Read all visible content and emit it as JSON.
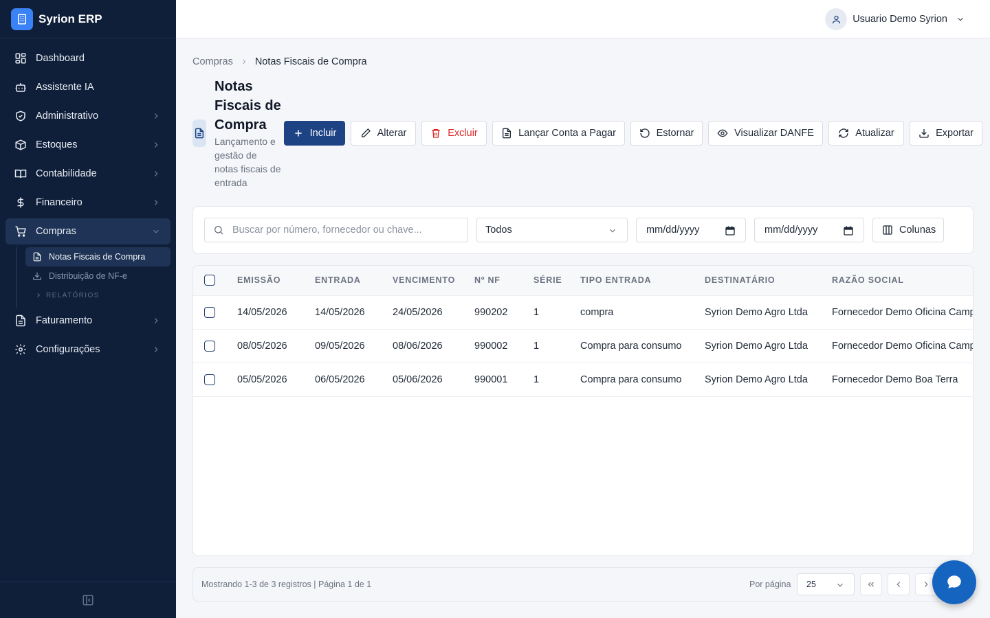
{
  "app": {
    "name": "Syrion ERP"
  },
  "sidebar": {
    "items": [
      {
        "label": "Dashboard",
        "icon": "dashboard-icon"
      },
      {
        "label": "Assistente IA",
        "icon": "bot-icon"
      },
      {
        "label": "Administrativo",
        "icon": "shield-icon"
      },
      {
        "label": "Estoques",
        "icon": "box-icon"
      },
      {
        "label": "Contabilidade",
        "icon": "book-icon"
      },
      {
        "label": "Financeiro",
        "icon": "dollar-icon"
      },
      {
        "label": "Compras",
        "icon": "cart-icon"
      },
      {
        "label": "Faturamento",
        "icon": "document-icon"
      },
      {
        "label": "Configurações",
        "icon": "gear-icon"
      }
    ],
    "compras_sub": [
      {
        "label": "Notas Fiscais de Compra"
      },
      {
        "label": "Distribuição de NF-e"
      }
    ],
    "section_label": "RELATÓRIOS"
  },
  "topbar": {
    "user_name": "Usuario Demo Syrion"
  },
  "breadcrumb": {
    "parent": "Compras",
    "current": "Notas Fiscais de Compra"
  },
  "page": {
    "title": "Notas Fiscais de Compra",
    "subtitle": "Lançamento e gestão de notas fiscais de entrada"
  },
  "actions": {
    "incluir": "Incluir",
    "alterar": "Alterar",
    "excluir": "Excluir",
    "lancar": "Lançar Conta a Pagar",
    "estornar": "Estornar",
    "danfe": "Visualizar DANFE",
    "atualizar": "Atualizar",
    "exportar": "Exportar"
  },
  "filters": {
    "search_placeholder": "Buscar por número, fornecedor ou chave...",
    "status_value": "Todos",
    "date_from_placeholder": "mm/dd/yyyy",
    "date_to_placeholder": "mm/dd/yyyy",
    "columns_label": "Colunas"
  },
  "table": {
    "headers": [
      "EMISSÃO",
      "ENTRADA",
      "VENCIMENTO",
      "Nº NF",
      "SÉRIE",
      "TIPO ENTRADA",
      "DESTINATÁRIO",
      "RAZÃO SOCIAL"
    ],
    "rows": [
      [
        "14/05/2026",
        "14/05/2026",
        "24/05/2026",
        "990202",
        "1",
        "compra",
        "Syrion Demo Agro Ltda",
        "Fornecedor Demo Oficina Campo"
      ],
      [
        "08/05/2026",
        "09/05/2026",
        "08/06/2026",
        "990002",
        "1",
        "Compra para consumo",
        "Syrion Demo Agro Ltda",
        "Fornecedor Demo Oficina Campo"
      ],
      [
        "05/05/2026",
        "06/05/2026",
        "05/06/2026",
        "990001",
        "1",
        "Compra para consumo",
        "Syrion Demo Agro Ltda",
        "Fornecedor Demo Boa Terra"
      ]
    ]
  },
  "pager": {
    "info": "Mostrando 1-3 de 3 registros | Página 1 de 1",
    "per_page_label": "Por página",
    "per_page_value": "25"
  },
  "colors": {
    "sidebar_bg": "#0f1f3a",
    "primary": "#1d4385",
    "danger": "#dc2626",
    "fab": "#1565c0"
  }
}
